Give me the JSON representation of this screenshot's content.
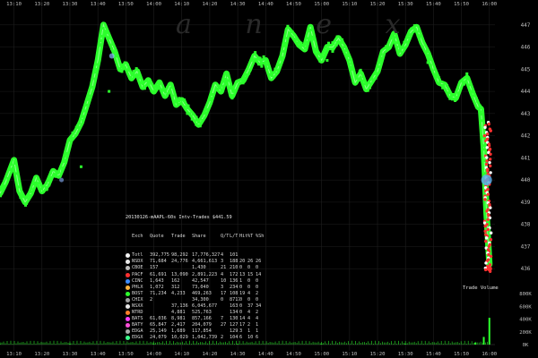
{
  "watermark": "a n e x",
  "colors": {
    "background": "#000000",
    "trade": "#2cff2c",
    "grid": "#1f1f1f",
    "volume": "#2cff2c",
    "nbbo": "#ff3030",
    "marker": "#5aa9e6"
  },
  "chart_data": [
    {
      "type": "line",
      "title": "",
      "x_ticks": [
        "13:10",
        "13:20",
        "13:30",
        "13:40",
        "13:50",
        "14:00",
        "14:10",
        "14:20",
        "14:30",
        "14:40",
        "14:50",
        "15:00",
        "15:10",
        "15:20",
        "15:30",
        "15:40",
        "15:50",
        "16:00"
      ],
      "y_ticks": [
        "447",
        "446",
        "445",
        "444",
        "443",
        "442",
        "441",
        "440",
        "439",
        "438",
        "437",
        "436"
      ],
      "ylim": [
        435.2,
        447.8
      ],
      "grid": true,
      "series": [
        {
          "x": [
            "13:05",
            "13:07",
            "13:10",
            "13:12",
            "13:14",
            "13:16",
            "13:18",
            "13:20",
            "13:22",
            "13:24",
            "13:26",
            "13:28",
            "13:30",
            "13:32",
            "13:34",
            "13:36",
            "13:38",
            "13:40",
            "13:42",
            "13:44",
            "13:46",
            "13:48",
            "13:50",
            "13:52",
            "13:54",
            "13:56",
            "13:58",
            "14:00",
            "14:02",
            "14:04",
            "14:06",
            "14:08",
            "14:10",
            "14:12",
            "14:14",
            "14:16",
            "14:18",
            "14:20",
            "14:22",
            "14:24",
            "14:26",
            "14:28",
            "14:30",
            "14:32",
            "14:34",
            "14:36",
            "14:38",
            "14:40",
            "14:42",
            "14:44",
            "14:46",
            "14:48",
            "14:50",
            "14:52",
            "14:54",
            "14:56",
            "14:58",
            "15:00",
            "15:02",
            "15:04",
            "15:06",
            "15:08",
            "15:10",
            "15:12",
            "15:14",
            "15:16",
            "15:18",
            "15:20",
            "15:22",
            "15:24",
            "15:26",
            "15:28",
            "15:30",
            "15:32",
            "15:34",
            "15:36",
            "15:38",
            "15:40",
            "15:42",
            "15:44",
            "15:46",
            "15:48",
            "15:50",
            "15:52",
            "15:54",
            "15:56",
            "15:57",
            "15:58",
            "15:59",
            "16:00"
          ],
          "y": [
            439.4,
            439.9,
            440.9,
            439.5,
            439.0,
            439.4,
            440.1,
            439.5,
            439.8,
            440.4,
            440.2,
            440.8,
            441.8,
            442.1,
            442.6,
            443.4,
            444.2,
            445.4,
            447.0,
            446.4,
            445.8,
            445.0,
            445.2,
            444.6,
            444.9,
            444.2,
            444.5,
            444.0,
            444.4,
            443.8,
            444.3,
            443.4,
            443.6,
            443.2,
            442.9,
            442.5,
            442.9,
            443.5,
            444.3,
            444.0,
            444.8,
            443.8,
            444.4,
            444.5,
            445.0,
            445.6,
            445.3,
            445.4,
            444.6,
            444.9,
            445.6,
            446.8,
            446.5,
            446.1,
            445.9,
            446.9,
            445.8,
            445.4,
            446.0,
            446.0,
            446.4,
            446.0,
            445.4,
            444.4,
            444.8,
            444.1,
            444.5,
            444.9,
            445.8,
            446.0,
            446.6,
            445.7,
            446.1,
            446.7,
            446.9,
            446.2,
            445.7,
            445.0,
            444.4,
            444.3,
            443.8,
            443.7,
            444.4,
            444.6,
            443.9,
            443.3,
            443.2,
            441.5,
            438.5,
            436.2
          ]
        }
      ]
    },
    {
      "type": "bar",
      "title": "Trade Volume",
      "y_ticks": [
        "800K",
        "600K",
        "400K",
        "200K",
        "0K"
      ],
      "ylim": [
        0,
        800000
      ],
      "x": [
        "13:05",
        "13:30",
        "14:00",
        "14:30",
        "15:00",
        "15:30",
        "15:55",
        "15:58",
        "16:00"
      ],
      "values": [
        6000,
        9000,
        8000,
        7000,
        8000,
        9000,
        30000,
        120000,
        420000
      ]
    }
  ],
  "stats": {
    "title": "20130126-mAAPL-60s Intv-Trades $441.59",
    "headers": [
      "Exch",
      "Quote",
      "Trade",
      "Share",
      "Q/T",
      "L/T",
      "Hit",
      "%T",
      "%Sh"
    ],
    "rows": [
      {
        "color": "#f4f4f4",
        "cells": [
          "Totl",
          "392,775",
          "98,292",
          "17,776,327",
          "4",
          "101",
          "",
          "",
          ""
        ]
      },
      {
        "color": "#e8e8e8",
        "cells": [
          "NSDX",
          "71,684",
          "24,776",
          "4,661,613",
          "3",
          "188",
          "20",
          "26",
          "26"
        ]
      },
      {
        "color": "#bdbdbd",
        "cells": [
          "CBOE",
          "157",
          "",
          "1,430",
          "21",
          "210",
          "0",
          "0",
          "0"
        ]
      },
      {
        "color": "#ff3030",
        "cells": [
          "PACF",
          "61,691",
          "13,090",
          "2,891,223",
          "4",
          "172",
          "13",
          "15",
          "14"
        ]
      },
      {
        "color": "#3c8cff",
        "cells": [
          "CINC",
          "1,643",
          "162",
          "42,547",
          "10",
          "136",
          "1",
          "0",
          "0"
        ]
      },
      {
        "color": "#ffb43c",
        "cells": [
          "PHLX",
          "1,072",
          "312",
          "73,040",
          "3",
          "234",
          "0",
          "0",
          "0"
        ]
      },
      {
        "color": "#2cff2c",
        "cells": [
          "BOST",
          "71,234",
          "4,233",
          "469,263",
          "17",
          "108",
          "19",
          "4",
          "2"
        ]
      },
      {
        "color": "#a0a0a0",
        "cells": [
          "CHIX",
          "2",
          "",
          "34,300",
          "0",
          "8717",
          "0",
          "0",
          "0"
        ]
      },
      {
        "color": "#e6e6e6",
        "cells": [
          "NSXX",
          "",
          "37,136",
          "6,045,677",
          "",
          "163",
          "0",
          "37",
          "34"
        ]
      },
      {
        "color": "#ff7f2a",
        "cells": [
          "NTRD",
          "",
          "4,881",
          "525,763",
          "",
          "134",
          "0",
          "4",
          "2"
        ]
      },
      {
        "color": "#ff3cff",
        "cells": [
          "BATS",
          "61,036",
          "8,981",
          "857,166",
          "7",
          "130",
          "14",
          "4",
          "4"
        ]
      },
      {
        "color": "#ff4fd8",
        "cells": [
          "BATY",
          "65,847",
          "2,417",
          "204,079",
          "27",
          "127",
          "17",
          "2",
          "1"
        ]
      },
      {
        "color": "#aaaaaa",
        "cells": [
          "EDGA",
          "25,149",
          "1,689",
          "117,854",
          "",
          "129",
          "3",
          "1",
          "1"
        ]
      },
      {
        "color": "#3cff8c",
        "cells": [
          "EDGX",
          "24,079",
          "10,029",
          "1,042,739",
          "2",
          "104",
          "6",
          "10",
          "6"
        ]
      }
    ]
  }
}
